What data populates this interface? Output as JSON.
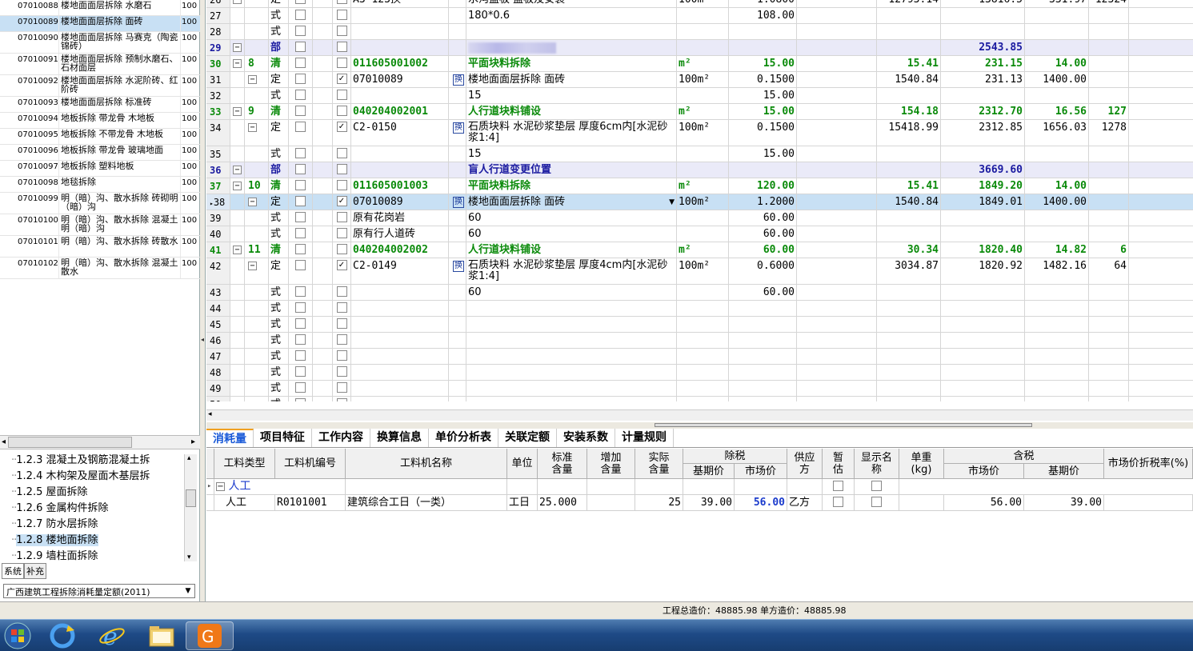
{
  "left_list": [
    {
      "code": "07010088",
      "name": "楼地面面层拆除 水磨石",
      "unit": "100"
    },
    {
      "code": "07010089",
      "name": "楼地面面层拆除 面砖",
      "unit": "100",
      "selected": true
    },
    {
      "code": "07010090",
      "name": "楼地面面层拆除 马赛克（陶瓷锦砖）",
      "unit": "100",
      "tall": true
    },
    {
      "code": "07010091",
      "name": "楼地面面层拆除 预制水磨石、石材面层",
      "unit": "100",
      "tall": true
    },
    {
      "code": "07010092",
      "name": "楼地面面层拆除 水泥阶砖、红阶砖",
      "unit": "100",
      "tall": true
    },
    {
      "code": "07010093",
      "name": "楼地面面层拆除 标准砖",
      "unit": "100"
    },
    {
      "code": "07010094",
      "name": "地板拆除 带龙骨 木地板",
      "unit": "100"
    },
    {
      "code": "07010095",
      "name": "地板拆除 不带龙骨 木地板",
      "unit": "100"
    },
    {
      "code": "07010096",
      "name": "地板拆除 带龙骨 玻璃地面",
      "unit": "100"
    },
    {
      "code": "07010097",
      "name": "地板拆除 塑料地板",
      "unit": "100"
    },
    {
      "code": "07010098",
      "name": "地毯拆除",
      "unit": "100"
    },
    {
      "code": "07010099",
      "name": "明（暗）沟、散水拆除 砖砌明（暗）沟",
      "unit": "100",
      "tall": true
    },
    {
      "code": "07010100",
      "name": "明（暗）沟、散水拆除 混凝土明（暗）沟",
      "unit": "100",
      "tall": true
    },
    {
      "code": "07010101",
      "name": "明（暗）沟、散水拆除 砖散水",
      "unit": "100",
      "tall": true
    },
    {
      "code": "07010102",
      "name": "明（暗）沟、散水拆除 混凝土散水",
      "unit": "100",
      "tall": true
    }
  ],
  "tree": [
    {
      "num": "1.2.3",
      "label": "混凝土及钢筋混凝土拆"
    },
    {
      "num": "1.2.4",
      "label": "木构架及屋面木基层拆"
    },
    {
      "num": "1.2.5",
      "label": "屋面拆除"
    },
    {
      "num": "1.2.6",
      "label": "金属构件拆除"
    },
    {
      "num": "1.2.7",
      "label": "防水层拆除"
    },
    {
      "num": "1.2.8",
      "label": "楼地面拆除",
      "selected": true
    },
    {
      "num": "1.2.9",
      "label": "墙柱面拆除"
    }
  ],
  "left_tabs": [
    "系统",
    "补充"
  ],
  "quota_lib": "广西建筑工程拆除消耗量定额(2011)",
  "grid_rows": [
    {
      "no": "26",
      "exp": "⊟",
      "type": "定",
      "c2": false,
      "c4": true,
      "code": "A3-123换",
      "huan": false,
      "name": "水沟盖板 盖板及安装",
      "unit": "100m",
      "qty": "1.0800",
      "p1": "12793.14",
      "p2": "13816.5",
      "p3": "331.97",
      "p4": "12324",
      "cls": ""
    },
    {
      "no": "27",
      "type": "式",
      "code": "",
      "name": "180*0.6",
      "qty": "108.00",
      "cls": ""
    },
    {
      "no": "28",
      "type": "式",
      "code": "",
      "name": "",
      "qty": "",
      "cls": ""
    },
    {
      "no": "29",
      "exp": "⊟",
      "type": "部",
      "code": "",
      "name": "",
      "blur": true,
      "qty": "",
      "p2": "2543.85",
      "cls": "bu"
    },
    {
      "no": "30",
      "exp": "⊟",
      "seq": "8",
      "type": "清",
      "code": "011605001002",
      "name": "平面块料拆除",
      "unit": "m²",
      "qty": "15.00",
      "p1": "15.41",
      "p2": "231.15",
      "p3": "14.00",
      "cls": "qing"
    },
    {
      "no": "31",
      "exp2": "⊟",
      "type": "定",
      "c4": true,
      "code": "07010089",
      "huan": true,
      "name": "楼地面面层拆除 面砖",
      "unit": "100m²",
      "qty": "0.1500",
      "p1": "1540.84",
      "p2": "231.13",
      "p3": "1400.00",
      "cls": ""
    },
    {
      "no": "32",
      "type": "式",
      "code": "",
      "name": "15",
      "qty": "15.00",
      "cls": ""
    },
    {
      "no": "33",
      "exp": "⊟",
      "seq": "9",
      "type": "清",
      "code": "040204002001",
      "name": "人行道块料铺设",
      "unit": "m²",
      "qty": "15.00",
      "p1": "154.18",
      "p2": "2312.70",
      "p3": "16.56",
      "p4": "127",
      "cls": "qing"
    },
    {
      "no": "34",
      "exp2": "⊟",
      "type": "定",
      "c4": true,
      "code": "C2-0150",
      "huan": true,
      "name": "石质块料 水泥砂浆垫层 厚度6cm内[水泥砂浆1:4]",
      "unit": "100m²",
      "qty": "0.1500",
      "p1": "15418.99",
      "p2": "2312.85",
      "p3": "1656.03",
      "p4": "1278",
      "cls": "tall"
    },
    {
      "no": "35",
      "type": "式",
      "code": "",
      "name": "15",
      "qty": "15.00",
      "cls": ""
    },
    {
      "no": "36",
      "exp": "⊟",
      "type": "部",
      "code": "",
      "name": "盲人行道变更位置",
      "qty": "",
      "p2": "3669.60",
      "cls": "bu"
    },
    {
      "no": "37",
      "exp": "⊟",
      "seq": "10",
      "type": "清",
      "code": "011605001003",
      "name": "平面块料拆除",
      "unit": "m²",
      "qty": "120.00",
      "p1": "15.41",
      "p2": "1849.20",
      "p3": "14.00",
      "cls": "qing"
    },
    {
      "no": "38",
      "exp2": "⊟",
      "type": "定",
      "c4": true,
      "code": "07010089",
      "huan": true,
      "name": "楼地面面层拆除 面砖",
      "unit": "100m²",
      "qty": "1.2000",
      "p1": "1540.84",
      "p2": "1849.01",
      "p3": "1400.00",
      "cls": "sel",
      "cur": true
    },
    {
      "no": "39",
      "type": "式",
      "code": "原有花岗岩",
      "name": "60",
      "qty": "60.00",
      "cls": ""
    },
    {
      "no": "40",
      "type": "式",
      "code": "原有行人道砖",
      "name": "60",
      "qty": "60.00",
      "cls": ""
    },
    {
      "no": "41",
      "exp": "⊟",
      "seq": "11",
      "type": "清",
      "code": "040204002002",
      "name": "人行道块料铺设",
      "unit": "m²",
      "qty": "60.00",
      "p1": "30.34",
      "p2": "1820.40",
      "p3": "14.82",
      "p4": "6",
      "cls": "qing"
    },
    {
      "no": "42",
      "exp2": "⊟",
      "type": "定",
      "c4": true,
      "code": "C2-0149",
      "huan": true,
      "name": "石质块料 水泥砂浆垫层 厚度4cm内[水泥砂浆1:4]",
      "unit": "100m²",
      "qty": "0.6000",
      "p1": "3034.87",
      "p2": "1820.92",
      "p3": "1482.16",
      "p4": "64",
      "cls": "tall"
    },
    {
      "no": "43",
      "type": "式",
      "code": "",
      "name": "60",
      "qty": "60.00",
      "cls": ""
    },
    {
      "no": "44",
      "type": "式",
      "code": "",
      "name": "",
      "qty": "",
      "cls": ""
    },
    {
      "no": "45",
      "type": "式",
      "code": "",
      "name": "",
      "qty": "",
      "cls": ""
    },
    {
      "no": "46",
      "type": "式",
      "code": "",
      "name": "",
      "qty": "",
      "cls": ""
    },
    {
      "no": "47",
      "type": "式",
      "code": "",
      "name": "",
      "qty": "",
      "cls": ""
    },
    {
      "no": "48",
      "type": "式",
      "code": "",
      "name": "",
      "qty": "",
      "cls": ""
    },
    {
      "no": "49",
      "type": "式",
      "code": "",
      "name": "",
      "qty": "",
      "cls": ""
    },
    {
      "no": "50",
      "type": "式",
      "code": "",
      "name": "",
      "qty": "",
      "cls": ""
    }
  ],
  "bottom_tabs": [
    "消耗量",
    "项目特征",
    "工作内容",
    "换算信息",
    "单价分析表",
    "关联定额",
    "安装系数",
    "计量规则"
  ],
  "bottom_headers": {
    "type": "工料类型",
    "code": "工料机编号",
    "name": "工料机名称",
    "unit": "单位",
    "std": "标准含量",
    "add": "增加含量",
    "actual": "实际含量",
    "notax": "除税",
    "base": "基期价",
    "market": "市场价",
    "supplier": "供应方",
    "temp": "暂估",
    "show": "显示名称",
    "weight": "单重(kg)",
    "tax": "含税",
    "tax_market": "市场价",
    "tax_base": "基期价",
    "rate": "市场价折税率(%)"
  },
  "bottom_group": "人工",
  "bottom_row": {
    "type": "人工",
    "code": "R0101001",
    "name": "建筑综合工日（一类）",
    "unit": "工日",
    "std": "25.000",
    "actual": "25",
    "base": "39.00",
    "market": "56.00",
    "supplier": "乙方",
    "tax_market": "56.00",
    "tax_base": "39.00"
  },
  "status": {
    "text": "工程总造价：48885.98  单方造价：48885.98"
  },
  "taskbar": [
    "start-orb",
    "ie-app",
    "ie-browser",
    "explorer",
    "gld-app"
  ],
  "colors": {
    "accent": "#1a5ad8",
    "bu": "#1a1aa0",
    "qing": "#0a8a0a",
    "select": "#c8e0f4"
  }
}
